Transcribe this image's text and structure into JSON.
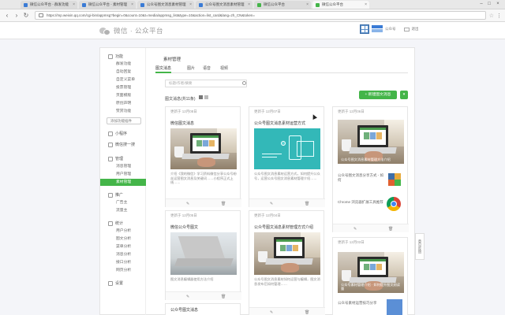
{
  "browser": {
    "tabs": [
      {
        "label": "微信公众平台 - 群发功能",
        "active": false
      },
      {
        "label": "微信公众平台 - 素材管理",
        "active": false
      },
      {
        "label": "公众号图文消息素材管理",
        "active": false
      },
      {
        "label": "公众号图文消息素材管理",
        "active": false
      },
      {
        "label": "微信公众平台",
        "active": false
      },
      {
        "label": "微信公众平台",
        "active": true
      }
    ],
    "url": "https://mp.weixin.qq.com/cgi-bin/appmsg?begin=0&count=10&t=media/appmsg_list&type=10&action=list_card&lang=zh_CN&token=",
    "window_controls": [
      "–",
      "□",
      "×"
    ]
  },
  "header": {
    "logo_text": "微信 · 公众平台",
    "account_name": "公众号",
    "logout_label": "退出"
  },
  "sidebar": {
    "groups": [
      {
        "label": "功能",
        "items": [
          "群发功能",
          "自动回复",
          "自定义菜单",
          "投票管理",
          "页面模版",
          "原创声明",
          "赞赏功能"
        ]
      },
      {
        "label": "添加功能插件",
        "items": []
      },
      {
        "label": "小程序",
        "items": []
      },
      {
        "label": "微信搜一搜",
        "items": []
      },
      {
        "label": "管理",
        "items": [
          "消息管理",
          "用户管理",
          "素材管理"
        ]
      },
      {
        "label": "推广",
        "items": [
          "广告主",
          "流量主"
        ]
      },
      {
        "label": "统计",
        "items": [
          "用户分析",
          "图文分析",
          "菜单分析",
          "消息分析",
          "接口分析",
          "网页分析"
        ]
      },
      {
        "label": "设置",
        "items": []
      }
    ],
    "active_item": "素材管理"
  },
  "main": {
    "page_title": "素材管理",
    "tabs": [
      "图文消息",
      "图片",
      "语音",
      "视频"
    ],
    "active_tab": "图文消息",
    "search_placeholder": "标题/作者/摘要",
    "count_label": "图文消息(共11条)",
    "new_button": "+ 新建图文消息",
    "new_dropdown": "▾"
  },
  "cards": [
    {
      "date": "更新于 12月08日",
      "title": "微信图文消息",
      "desc": "介绍《我的微信》学习资料微信分享公众号粉丝运营图文消息及关键词……小程序正式上线……"
    },
    {
      "date": "更新于 12月07日",
      "title": "公众号图文消息素材运营方式",
      "desc": "公众号图文消息素材运营方式，如何提升公众号，运营公众号图文消息素材管理介绍……"
    },
    {
      "date": "更新于 12月06日",
      "title": "",
      "img_caption": "公众号图文消息素材管理方法介绍",
      "rows": [
        "公众号图文消息分享方式 - 如何",
        "Chrome 浏览器扩展工具推荐"
      ]
    },
    {
      "date": "更新于 12月05日",
      "title": "微信公众号图文",
      "desc": "图文消息编辑器使用方法介绍"
    },
    {
      "date": "更新于 12月04日",
      "title": "公众号图文消息素材管理方式介绍",
      "desc": "公众号图文消息素材如何运营与编辑，图文消息发布后如何管理……"
    },
    {
      "date": "更新于 12月03日",
      "title": "",
      "img_caption": "公众号素材管理介绍 · 如何提升图文阅读量",
      "rows": [
        "公众号素材运营技巧分享"
      ]
    },
    {
      "date": "更新于 12月02日",
      "title": "公众号图文消息"
    }
  ],
  "card_actions": {
    "edit": "✎",
    "delete": "🗑"
  },
  "float_tab": "意见反馈",
  "colors": {
    "accent": "#44b549",
    "teal": "#33b8b8"
  }
}
